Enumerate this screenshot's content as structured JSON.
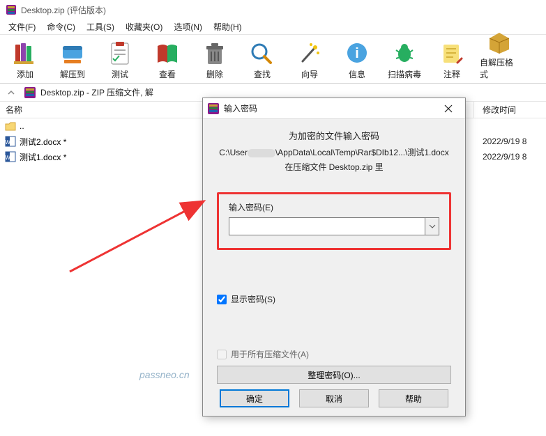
{
  "window": {
    "title": "Desktop.zip (评估版本)"
  },
  "menu": {
    "file": "文件(F)",
    "command": "命令(C)",
    "tools": "工具(S)",
    "favorites": "收藏夹(O)",
    "options": "选项(N)",
    "help": "帮助(H)"
  },
  "toolbar": {
    "add": "添加",
    "extract": "解压到",
    "test": "测试",
    "view": "查看",
    "delete": "删除",
    "find": "查找",
    "wizard": "向导",
    "info": "信息",
    "virus": "扫描病毒",
    "comment": "注释",
    "sfx": "自解压格式"
  },
  "breadcrumb": {
    "text": "Desktop.zip - ZIP 压缩文件, 解"
  },
  "columns": {
    "name": "名称",
    "date": "修改时间"
  },
  "files": {
    "up": "..",
    "items": [
      {
        "name": "测试2.docx *",
        "date": "2022/9/19 8"
      },
      {
        "name": "测试1.docx *",
        "date": "2022/9/19 8"
      }
    ]
  },
  "dialog": {
    "title": "输入密码",
    "msg1": "为加密的文件输入密码",
    "path_prefix": "C:\\User",
    "path_suffix": "\\AppData\\Local\\Temp\\Rar$DIb12...\\测试1.docx",
    "msg3": "在压缩文件 Desktop.zip 里",
    "password_label": "输入密码(E)",
    "password_value": "",
    "show_password": "显示密码(S)",
    "apply_all": "用于所有压缩文件(A)",
    "manage": "整理密码(O)...",
    "ok": "确定",
    "cancel": "取消",
    "help": "帮助"
  },
  "watermark": "passneo.cn"
}
